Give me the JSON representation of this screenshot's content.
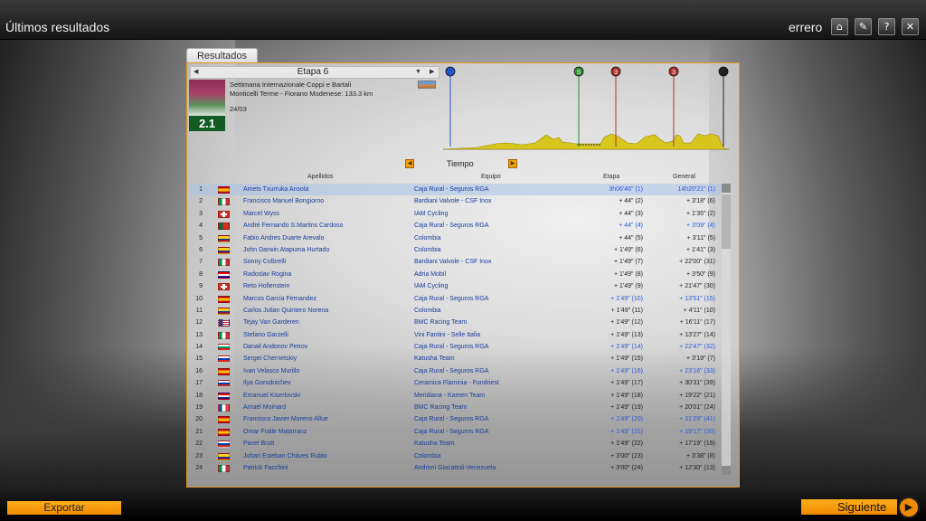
{
  "window": {
    "title": "Últimos resultados",
    "user": "errero",
    "buttons": [
      {
        "icon": "home-icon",
        "glyph": "⌂"
      },
      {
        "icon": "wrench-icon",
        "glyph": "✎"
      },
      {
        "icon": "help-icon",
        "glyph": "?"
      },
      {
        "icon": "close-icon",
        "glyph": "✕"
      }
    ]
  },
  "tab": {
    "label": "Resultados"
  },
  "stage": {
    "title": "Etapa 6",
    "race_name": "Settimana Internazionale Coppi e Bartali",
    "route": "Monticelli Terme - Fiorano Modenese: 133.3 km",
    "date": "24/03",
    "category": "2.1"
  },
  "profile_markers": [
    {
      "type": "start",
      "color": "#2255cc",
      "glyph": ""
    },
    {
      "type": "sprint",
      "color": "#2e8b2e",
      "glyph": "S"
    },
    {
      "type": "climb",
      "color": "#b03030",
      "glyph": "3"
    },
    {
      "type": "climb",
      "color": "#b03030",
      "glyph": "3"
    },
    {
      "type": "finish",
      "color": "#222222",
      "glyph": ""
    }
  ],
  "ranking_selector": {
    "label": "Tiempo"
  },
  "columns": {
    "name": "Apellidos",
    "team": "Equipo",
    "stage": "Etapa",
    "general": "General"
  },
  "rows": [
    {
      "pos": "1",
      "flag": "es",
      "name": "Amets Txurruka Ansola",
      "team": "Caja Rural - Seguros RGA",
      "stage": "3h06'46\" (1)",
      "general": "14h20'21\" (1)",
      "stage_hl": true,
      "gen_hl": true,
      "sel": true
    },
    {
      "pos": "2",
      "flag": "it",
      "name": "Francisco Manuel Bongiorno",
      "team": "Bardiani Valvole - CSF Inox",
      "stage": "+ 44\" (2)",
      "general": "+ 3'18\" (6)"
    },
    {
      "pos": "3",
      "flag": "ch",
      "name": "Marcel Wyss",
      "team": "IAM Cycling",
      "stage": "+ 44\" (3)",
      "general": "+ 1'35\" (2)"
    },
    {
      "pos": "4",
      "flag": "pt",
      "name": "André Fernando S.Martins Cardoso",
      "team": "Caja Rural - Seguros RGA",
      "stage": "+ 44\" (4)",
      "general": "+ 3'09\" (4)",
      "stage_hl": true,
      "gen_hl": true
    },
    {
      "pos": "5",
      "flag": "co",
      "name": "Fabio Andres Duarte Arevalo",
      "team": "Colombia",
      "stage": "+ 44\" (5)",
      "general": "+ 3'11\" (5)"
    },
    {
      "pos": "6",
      "flag": "co",
      "name": "John Darwin Atapuma Hurtado",
      "team": "Colombia",
      "stage": "+ 1'49\" (6)",
      "general": "+ 1'41\" (3)"
    },
    {
      "pos": "7",
      "flag": "it",
      "name": "Sonny Colbrelli",
      "team": "Bardiani Valvole - CSF Inox",
      "stage": "+ 1'49\" (7)",
      "general": "+ 22'00\" (31)"
    },
    {
      "pos": "8",
      "flag": "hr",
      "name": "Radoslav Rogina",
      "team": "Adria Mobil",
      "stage": "+ 1'49\" (8)",
      "general": "+ 3'50\" (9)"
    },
    {
      "pos": "9",
      "flag": "ch",
      "name": "Reto Hollenstein",
      "team": "IAM Cycling",
      "stage": "+ 1'49\" (9)",
      "general": "+ 21'47\" (30)"
    },
    {
      "pos": "10",
      "flag": "es",
      "name": "Marcos Garcia Fernandez",
      "team": "Caja Rural - Seguros RGA",
      "stage": "+ 1'49\" (10)",
      "general": "+ 13'51\" (15)",
      "stage_hl": true,
      "gen_hl": true
    },
    {
      "pos": "11",
      "flag": "co",
      "name": "Carlos Julian Quintero Norena",
      "team": "Colombia",
      "stage": "+ 1'49\" (11)",
      "general": "+ 4'11\" (10)"
    },
    {
      "pos": "12",
      "flag": "us",
      "name": "Tejay Van Garderen",
      "team": "BMC Racing Team",
      "stage": "+ 1'49\" (12)",
      "general": "+ 16'11\" (17)"
    },
    {
      "pos": "13",
      "flag": "it",
      "name": "Stefano Garzelli",
      "team": "Vini Fantini - Selle Italia",
      "stage": "+ 1'49\" (13)",
      "general": "+ 13'27\" (14)"
    },
    {
      "pos": "14",
      "flag": "bg",
      "name": "Danail Andonov Petrov",
      "team": "Caja Rural - Seguros RGA",
      "stage": "+ 1'49\" (14)",
      "general": "+ 22'47\" (32)",
      "stage_hl": true,
      "gen_hl": true
    },
    {
      "pos": "15",
      "flag": "ru",
      "name": "Sergei Chernetskiy",
      "team": "Katusha Team",
      "stage": "+ 1'49\" (15)",
      "general": "+ 3'19\" (7)"
    },
    {
      "pos": "16",
      "flag": "es",
      "name": "Ivan Velasco Murillo",
      "team": "Caja Rural - Seguros RGA",
      "stage": "+ 1'49\" (16)",
      "general": "+ 23'16\" (33)",
      "stage_hl": true,
      "gen_hl": true
    },
    {
      "pos": "17",
      "flag": "ru",
      "name": "Ilya Gorodnichev",
      "team": "Ceramica Flaminia - Fondriest",
      "stage": "+ 1'49\" (17)",
      "general": "+ 30'31\" (39)"
    },
    {
      "pos": "18",
      "flag": "hr",
      "name": "Emanuel Kiserlovski",
      "team": "Meridiana - Kamen Team",
      "stage": "+ 1'49\" (18)",
      "general": "+ 19'22\" (21)"
    },
    {
      "pos": "19",
      "flag": "fr",
      "name": "Amaël Moinard",
      "team": "BMC Racing Team",
      "stage": "+ 1'49\" (19)",
      "general": "+ 20'01\" (24)"
    },
    {
      "pos": "20",
      "flag": "es",
      "name": "Francisco Javier Moreno Allue",
      "team": "Caja Rural - Seguros RGA",
      "stage": "+ 1'49\" (20)",
      "general": "+ 31'29\" (41)",
      "stage_hl": true,
      "gen_hl": true
    },
    {
      "pos": "21",
      "flag": "es",
      "name": "Omar Fraile Matarranz",
      "team": "Caja Rural - Seguros RGA",
      "stage": "+ 1'49\" (21)",
      "general": "+ 19'17\" (20)",
      "stage_hl": true,
      "gen_hl": true
    },
    {
      "pos": "22",
      "flag": "ru",
      "name": "Pavel Brutt",
      "team": "Katusha Team",
      "stage": "+ 1'49\" (22)",
      "general": "+ 17'19\" (19)"
    },
    {
      "pos": "23",
      "flag": "co",
      "name": "Johan Esteban Cháves Rubio",
      "team": "Colombia",
      "stage": "+ 3'00\" (23)",
      "general": "+ 3'38\" (8)"
    },
    {
      "pos": "24",
      "flag": "it",
      "name": "Patrick Facchini",
      "team": "Androni Giocattoli-Venezuela",
      "stage": "+ 3'00\" (24)",
      "general": "+ 12'30\" (13)"
    }
  ],
  "flags": {
    "es": [
      "#c60b1e",
      "#ffc400",
      "#c60b1e"
    ],
    "it": [
      "#009246",
      "#ffffff",
      "#ce2b37"
    ],
    "ch": [
      "#d52b1e"
    ],
    "pt": [
      "#046a38",
      "#da291c"
    ],
    "co": [
      "#fcd116",
      "#003893",
      "#ce1126"
    ],
    "hr": [
      "#ff0000",
      "#ffffff",
      "#171796"
    ],
    "us": [
      "#b22234",
      "#ffffff",
      "#3c3b6e"
    ],
    "bg": [
      "#ffffff",
      "#00966e",
      "#d62612"
    ],
    "ru": [
      "#ffffff",
      "#0039a6",
      "#d52b1e"
    ],
    "fr": [
      "#0055a4",
      "#ffffff",
      "#ef4135"
    ]
  },
  "footer": {
    "export_label": "Exportar",
    "next_label": "Siguiente"
  },
  "colors": {
    "accent": "#f0960f",
    "link": "#1a3c9e",
    "highlight": "#2f58d8",
    "category_bg": "#135a23"
  }
}
